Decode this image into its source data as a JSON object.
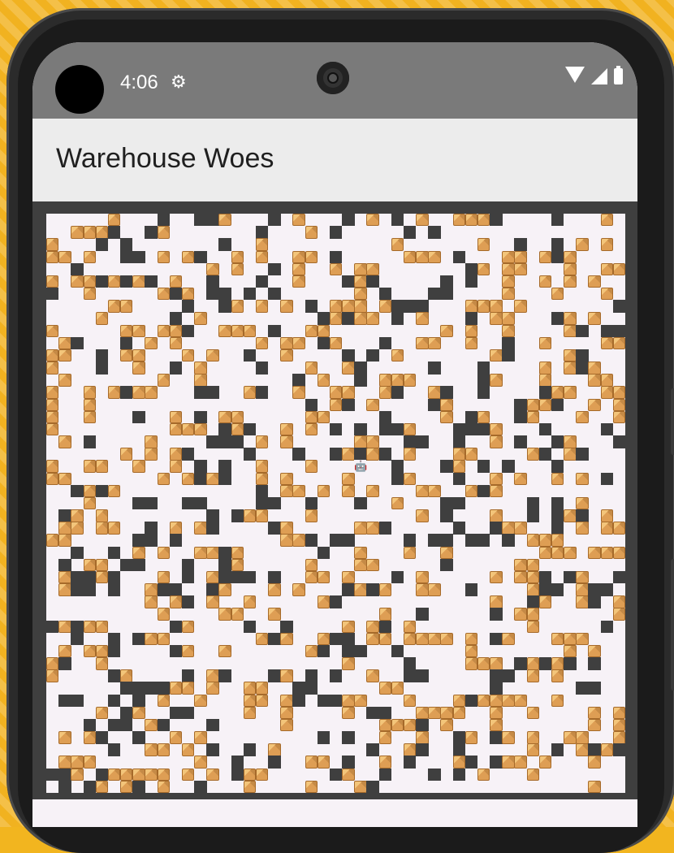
{
  "status_bar": {
    "time": "4:06",
    "settings_icon": "gear-icon",
    "wifi_icon": "wifi-icon",
    "signal_icon": "signal-icon",
    "battery_icon": "battery-icon"
  },
  "app": {
    "title": "Warehouse Woes"
  },
  "board": {
    "size": 47,
    "seed": 137,
    "wall_color": "#3f3f3f",
    "floor_color": "#f7f2f7",
    "box_color": "#de9e54",
    "robot_icon": "robot-icon",
    "robot_glyph": "🤖",
    "robot_cell": {
      "col": 25,
      "row": 20
    }
  }
}
